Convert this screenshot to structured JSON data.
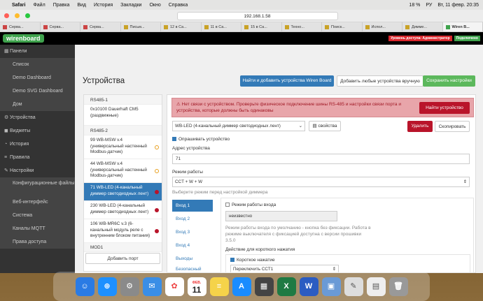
{
  "macbar": {
    "apple": "",
    "app": "Safari",
    "menus": [
      "Файл",
      "Правка",
      "Вид",
      "История",
      "Закладки",
      "Окно",
      "Справка"
    ],
    "battery": "18 %",
    "lang": "РУ",
    "clock": "Вт, 11 февр. 20:35"
  },
  "browser": {
    "url": "192.168.1.58",
    "tabs": [
      "Серва...",
      "Серва...",
      "Серва...",
      "Письм...",
      "12 в Са...",
      "11 в Са...",
      "15 в Са...",
      "Техно...",
      "Поиск...",
      "Испол...",
      "Димме...",
      "Wiren B..."
    ]
  },
  "appbar": {
    "logo": "wirenboard",
    "role": "Уровень доступа: Администратор",
    "conn": "Подключено"
  },
  "sidebar": {
    "items": [
      {
        "label": "Панели",
        "icon": "▦"
      },
      {
        "label": "Список",
        "sub": true
      },
      {
        "label": "Demo Dashboard",
        "sub": true
      },
      {
        "label": "Demo SVG Dashboard",
        "sub": true
      },
      {
        "label": "Дом",
        "sub": true
      },
      {
        "label": "Устройства",
        "icon": "⚙"
      },
      {
        "label": "Виджеты",
        "icon": "◼"
      },
      {
        "label": "История",
        "icon": "◔"
      },
      {
        "label": "Правила",
        "icon": "≡"
      },
      {
        "label": "Настройки",
        "icon": "✎"
      },
      {
        "label": "Конфигурационные файлы",
        "sub": true
      },
      {
        "label": "Веб-интерфейс",
        "sub": true
      },
      {
        "label": "Система",
        "sub": true
      },
      {
        "label": "Каналы MQTT",
        "sub": true
      },
      {
        "label": "Права доступа",
        "sub": true
      }
    ]
  },
  "main": {
    "title": "Устройства",
    "btn_find": "Найти и добавить устройства Wiren Board",
    "btn_add": "Добавить любые устройства вручную",
    "btn_save": "Сохранить настройки",
    "devices": [
      {
        "label": "RS485-1",
        "group": true
      },
      {
        "label": "0x10100 Dauerhaft CM5 (раздвижные)"
      },
      {
        "label": "RS485-2",
        "group": true
      },
      {
        "label": "99 WB-MSW v.4 (универсальный настенный Modbus-датчик)",
        "mark": "sync"
      },
      {
        "label": "44 WB-MSW v.4 (универсальный настенный Modbus-датчик)",
        "mark": "sync"
      },
      {
        "label": "71 WB-LED (4-канальный диммер светодиодных лент)",
        "mark": "err",
        "sel": true
      },
      {
        "label": "230 WB-LED (4-канальный диммер светодиодных лент)",
        "mark": "err"
      },
      {
        "label": "106 WB-MR6C v.3 (6-канальный модуль реле с внутренним блоком питания)",
        "mark": "err"
      },
      {
        "label": "MOD1",
        "group": true
      }
    ],
    "btn_add_port": "Добавить порт",
    "alert": "⚠ Нет связи с устройством. Проверьте физическое подключение шины RS-485 и настройки связи порта и устройства, которые должны быть одинаковы",
    "btn_find_device": "Найти устройство",
    "device_select": "WB-LED (4-канальный диммер светодиодных лент)",
    "btn_props": "свойства",
    "btn_delete": "Удалить",
    "btn_copy": "Скопировать",
    "poll_label": "Опрашивать устройство",
    "addr_label": "Адрес устройства",
    "addr_value": "71",
    "mode_label": "Режим работы",
    "mode_value": "CCT + W + W",
    "mode_hint": "Выберите режим перед настройкой диммера",
    "vtabs": [
      "Вход 1",
      "Вход 2",
      "Вход 3",
      "Вход 4",
      "Выходы",
      "Безопасный режим"
    ],
    "input_mode_label": "Режим работы входа",
    "input_mode_value": "неизвестно",
    "input_hint": "Режим работы входа по умолчанию - кнопка без фиксации. Работа в режиме выключателя с фиксацией доступна с версии прошивки 3.5.0",
    "short_action_label": "Действие для короткого нажатия",
    "short_press_label": "Короткое нажатие",
    "short_press_value": "Переключить CCT1"
  },
  "dock": {
    "date_month": "ФЕВ.",
    "date_day": "11"
  }
}
